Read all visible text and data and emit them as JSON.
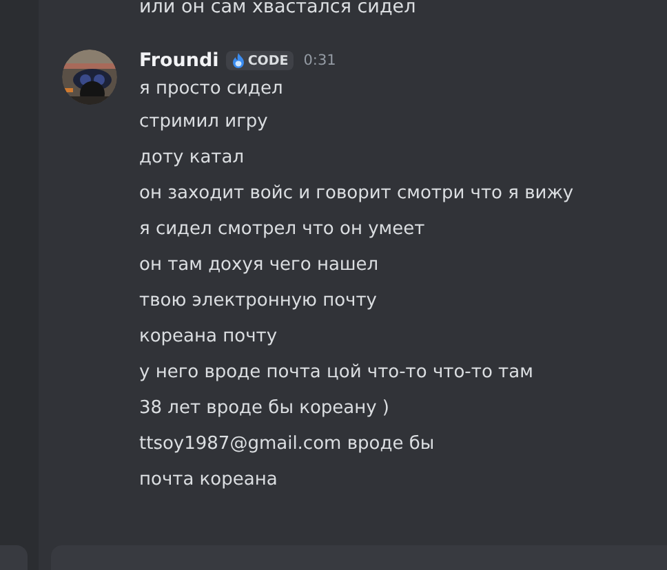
{
  "previous_message": {
    "text": "или он сам хвастался сидел"
  },
  "message": {
    "author": "Froundi",
    "tag": "CODE",
    "time": "0:31",
    "lines": [
      "я просто сидел",
      "стримил игру",
      "доту катал",
      "он заходит войс и говорит смотри что я вижу",
      "я сидел смотрел что он умеет",
      "он там дохуя чего нашел",
      "твою электронную почту",
      "кореана почту",
      "у него вроде почта цой что-то что-то там",
      "38 лет вроде бы кореану )",
      "ttsoy1987@gmail.com вроде бы",
      "почта кореана"
    ]
  }
}
